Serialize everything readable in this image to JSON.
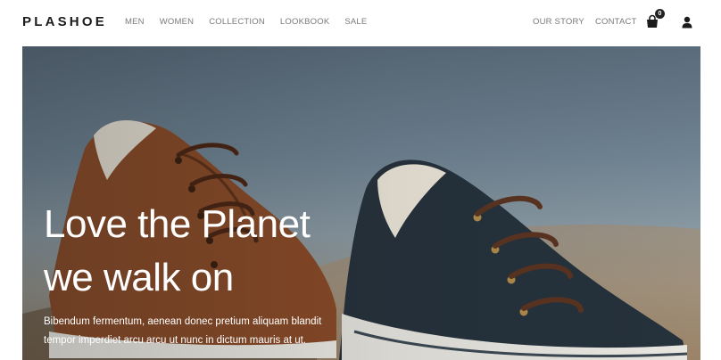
{
  "brand": {
    "name": "PLASHOE"
  },
  "nav": {
    "primary": [
      {
        "label": "MEN"
      },
      {
        "label": "WOMEN"
      },
      {
        "label": "COLLECTION"
      },
      {
        "label": "LOOKBOOK"
      },
      {
        "label": "SALE"
      }
    ],
    "secondary": [
      {
        "label": "OUR STORY"
      },
      {
        "label": "CONTACT"
      }
    ]
  },
  "cart": {
    "icon": "shopping-bag-icon",
    "count": "0"
  },
  "account": {
    "icon": "user-icon"
  },
  "hero": {
    "title_line1": "Love the Planet",
    "title_line2": "we walk on",
    "description": "Bibendum fermentum, aenean donec pretium aliquam blandit tempor imperdiet arcu arcu ut nunc in dictum mauris at ut."
  },
  "colors": {
    "text_dark": "#1b1b1b",
    "nav_text": "#7a7a7a",
    "hero_text": "#ffffff",
    "brown_shoe": "#8a4a26",
    "navy_shoe": "#25313b"
  }
}
